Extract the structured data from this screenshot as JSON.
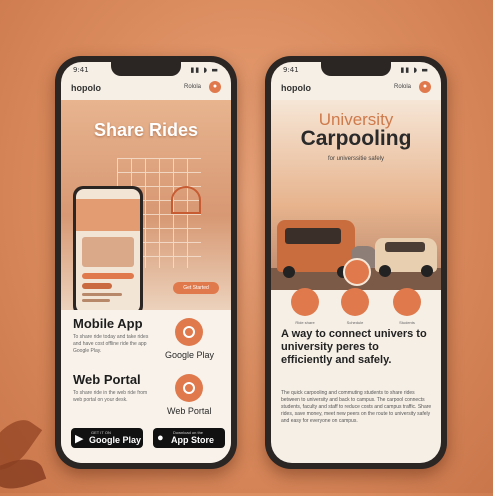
{
  "left_phone": {
    "status_time": "9:41",
    "status_icons": "▮▮ ◗ ▬",
    "brand": "hopolo",
    "app_tag": "Rolola",
    "hero_title": "Share Rides",
    "pill_text": "Get Started",
    "mobile_app": {
      "title": "Mobile App",
      "text": "To share ride today and take rides and have cost offline ride the app Google Play.",
      "side_label": "Google Play"
    },
    "web_portal": {
      "title": "Web Portal",
      "text": "To share ride in the web ride from web portal on your desk.",
      "side_label": "Web Portal"
    },
    "stores": [
      {
        "small": "GET IT ON",
        "big": "Google Play",
        "glyph": "▶"
      },
      {
        "small": "Download on the",
        "big": "App Store",
        "glyph": "●"
      }
    ]
  },
  "right_phone": {
    "status_time": "9:41",
    "status_icons": "▮▮ ◗ ▬",
    "brand": "hopolo",
    "app_tag": "Rolola",
    "title_line1": "University",
    "title_line2": "Carpooling",
    "subtitle": "for universsitie safely",
    "features": [
      {
        "label": "Ride share"
      },
      {
        "label": "Schedule"
      },
      {
        "label": "Students"
      }
    ],
    "tagline": "A way to connect univers to university peres to efficiently and safely.",
    "body": "The quick carpooling and commuting students to share rides between to university and back to campus. The carpool connects students, faculty and staff to reduce costs and campus traffic. Share rides, save money, meet new peers on the route to university safely and easy for everyone on campus."
  },
  "colors": {
    "accent": "#e07a4d",
    "background": "#d98a5c",
    "phone_frame": "#2b2523"
  }
}
